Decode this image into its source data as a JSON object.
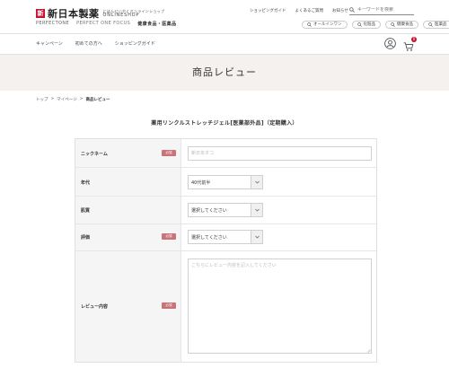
{
  "header": {
    "logo_mark": "新",
    "logo_text": "新日本製薬",
    "logo_sub_line1": "にほんせいやくオンラインショップ",
    "logo_sub_line2": "ONLINESHOP",
    "brands": [
      "PERFECTONE",
      "PERFECT ONE FOCUS",
      "健康食品・医薬品"
    ],
    "util_links": [
      "ショッピングガイド",
      "よくあるご質問",
      "お知らせ"
    ],
    "search_placeholder": "キーワードを検索",
    "pills": [
      "オールインワン",
      "化粧品",
      "健康食品",
      "医薬品"
    ]
  },
  "nav": {
    "items": [
      "キャンペーン",
      "初めての方へ",
      "ショッピングガイド"
    ],
    "cart_count": "0"
  },
  "page": {
    "title": "商品レビュー",
    "breadcrumb": [
      "トップ",
      "マイページ",
      "商品レビュー"
    ],
    "breadcrumb_sep": ">",
    "product_title": "薬用リンクルストレッチジェル[医薬部外品]（定期購入）"
  },
  "form": {
    "required_label": "必須",
    "nickname": {
      "label": "ニックネーム",
      "placeholder": "新日本ダコ",
      "value": ""
    },
    "age": {
      "label": "年代",
      "selected": "40代前半"
    },
    "skin": {
      "label": "肌質",
      "selected": "選択してください"
    },
    "rating": {
      "label": "評価",
      "selected": "選択してください"
    },
    "review": {
      "label": "レビュー内容",
      "placeholder": "こちらにレビュー内容を記入してください"
    }
  },
  "colors": {
    "accent": "#c8102e",
    "required_badge": "#c9747a",
    "hero_bg": "#f5f1ee"
  }
}
